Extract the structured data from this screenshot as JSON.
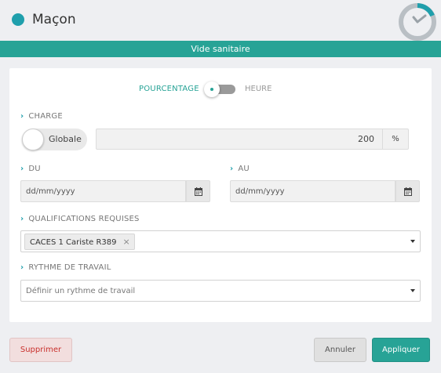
{
  "header": {
    "title": "Maçon",
    "accent_color": "#1f9fac",
    "clock_icon": "clock-icon"
  },
  "banner": {
    "text": "Vide sanitaire",
    "color": "#27a396"
  },
  "mode_toggle": {
    "left_label": "POURCENTAGE",
    "right_label": "HEURE",
    "selected": "POURCENTAGE"
  },
  "charge": {
    "label": "CHARGE",
    "switch_label": "Globale",
    "value": "200",
    "unit": "%"
  },
  "du": {
    "label": "DU",
    "placeholder": "dd/mm/yyyy",
    "icon": "calendar-icon"
  },
  "au": {
    "label": "AU",
    "placeholder": "dd/mm/yyyy",
    "icon": "calendar-icon"
  },
  "qualifications": {
    "label": "QUALIFICATIONS REQUISES",
    "tags": [
      "CACES 1 Cariste R389"
    ],
    "remove_glyph": "×"
  },
  "rythme": {
    "label": "RYTHME DE TRAVAIL",
    "placeholder": "Définir un rythme de travail"
  },
  "footer": {
    "delete_label": "Supprimer",
    "cancel_label": "Annuler",
    "apply_label": "Appliquer"
  }
}
